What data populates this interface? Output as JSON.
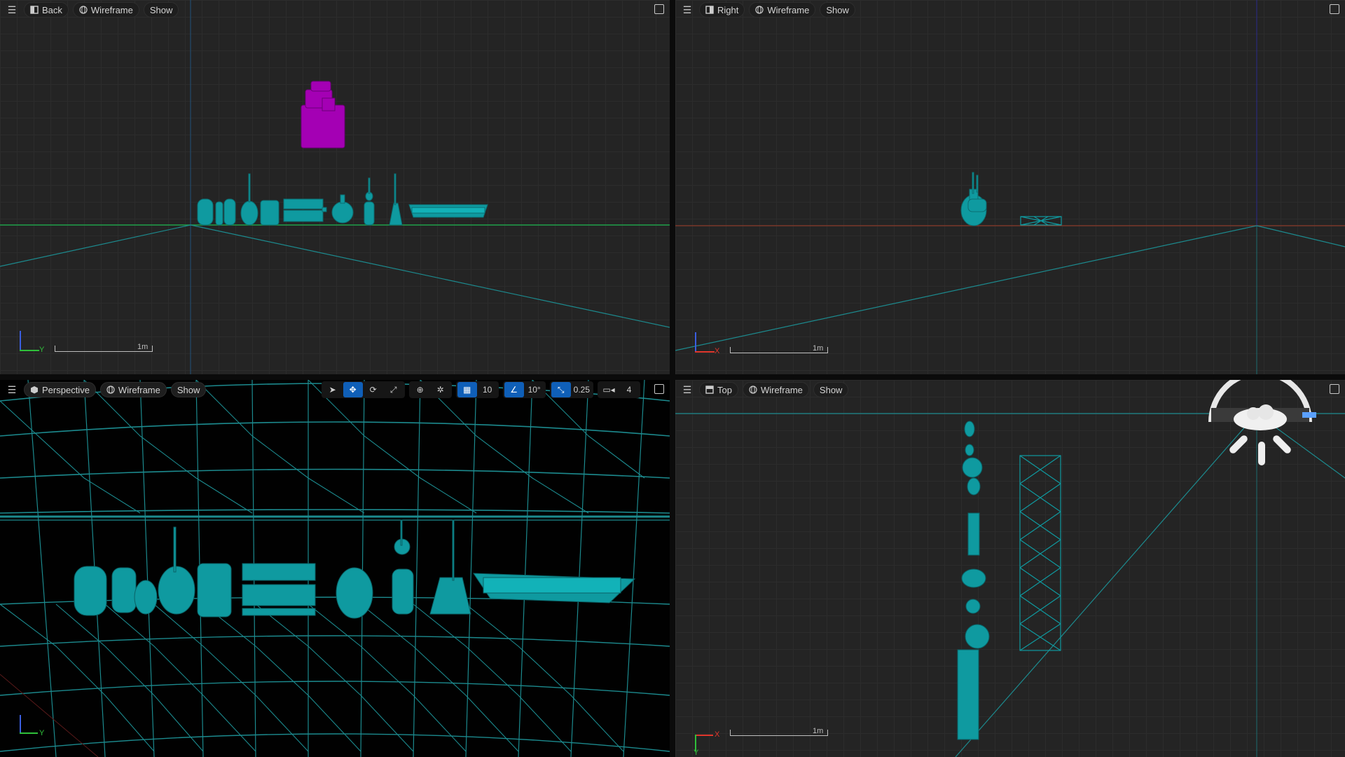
{
  "viewports": {
    "back": {
      "view_label": "Back",
      "mode_label": "Wireframe",
      "show_label": "Show",
      "scale_label": "1m",
      "axis_right": "Y"
    },
    "right": {
      "view_label": "Right",
      "mode_label": "Wireframe",
      "show_label": "Show",
      "scale_label": "1m",
      "axis_right": "X"
    },
    "perspective": {
      "view_label": "Perspective",
      "mode_label": "Wireframe",
      "show_label": "Show",
      "axis_right": "Y",
      "toolbar": {
        "grid_snap": "10",
        "rotate_snap": "10°",
        "scale_snap": "0.25",
        "camera_speed": "4"
      }
    },
    "top": {
      "view_label": "Top",
      "mode_label": "Wireframe",
      "show_label": "Show",
      "scale_label": "1m",
      "axis_right": "X",
      "axis_down": "Y"
    }
  },
  "colors": {
    "mesh": "#0f9aa0",
    "selected": "#a400b4",
    "grid_line": "#2c2c2c",
    "accent": "#0f5fb8"
  },
  "icons": [
    "hamburger-menu-icon",
    "maximize-icon",
    "view-cube-icon",
    "wireframe-sphere-icon",
    "select-arrow-icon",
    "translate-icon",
    "rotate-icon",
    "scale-icon",
    "world-space-icon",
    "surface-snap-icon",
    "grid-snap-icon",
    "rotate-snap-icon",
    "scale-snap-icon",
    "camera-speed-icon",
    "sky-light-icon"
  ]
}
